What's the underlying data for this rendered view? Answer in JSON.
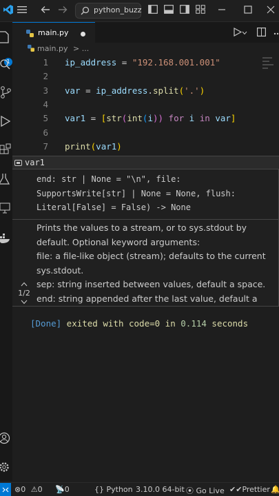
{
  "titlebar": {
    "search_text": "python_buzz"
  },
  "tab": {
    "label": "main.py"
  },
  "breadcrumb": {
    "file": "main.py",
    "sep": "> ..."
  },
  "editor": {
    "lines": [
      {
        "n": "1"
      },
      {
        "n": "2"
      },
      {
        "n": "3"
      },
      {
        "n": "4"
      },
      {
        "n": "5"
      },
      {
        "n": "6"
      },
      {
        "n": "7"
      }
    ],
    "code": {
      "l1_var": "ip_address",
      "l1_eq": " = ",
      "l1_str": "\"192.168.001.001\"",
      "l3_var": "var",
      "l3_eq": " = ",
      "l3_obj": "ip_address",
      "l3_dot": ".",
      "l3_fn": "split",
      "l3_open": "(",
      "l3_arg": "'.'",
      "l3_close": ")",
      "l5_var": "var1",
      "l5_eq": " = ",
      "l5_lb": "[",
      "l5_str": "str",
      "l5_p1": "(",
      "l5_int": "int",
      "l5_p2": "(",
      "l5_i": "i",
      "l5_p3": "))",
      "l5_for": " for ",
      "l5_i2": "i",
      "l5_in": " in ",
      "l5_var2": "var",
      "l5_rb": "]",
      "l7_fn": "print",
      "l7_open": "(",
      "l7_arg": "var1",
      "l7_close": ")"
    }
  },
  "hover": {
    "symbol": "var1",
    "signature": "end: str | None = \"\\n\", file:\nSupportsWrite[str] | None = None, flush:\nLiteral[False] = False) -> None",
    "doc_lines": [
      "Prints the values to a stream, or to sys.stdout by",
      "default. Optional keyword arguments:",
      "file: a file-like object (stream); defaults to the current",
      "sys.stdout.",
      "sep: string inserted between values, default a space.",
      "end: string appended after the last value, default a"
    ],
    "overload": "1/2"
  },
  "output": {
    "done": "[Done]",
    "msg1": " exited with ",
    "code": "code=0",
    "msg2": " in ",
    "secs": "0.114",
    "msg3": " seconds"
  },
  "statusbar": {
    "errors": "0",
    "warnings": "0",
    "info": "0",
    "language": "Python",
    "interpreter": "3.10.0 64-bit",
    "golive": "Go Live",
    "prettier": "Prettier"
  },
  "colors": {
    "accent": "#0078d4",
    "background": "#1e1e1e",
    "string": "#ce9178",
    "keyword": "#c586c0",
    "function": "#dcdcaa"
  }
}
